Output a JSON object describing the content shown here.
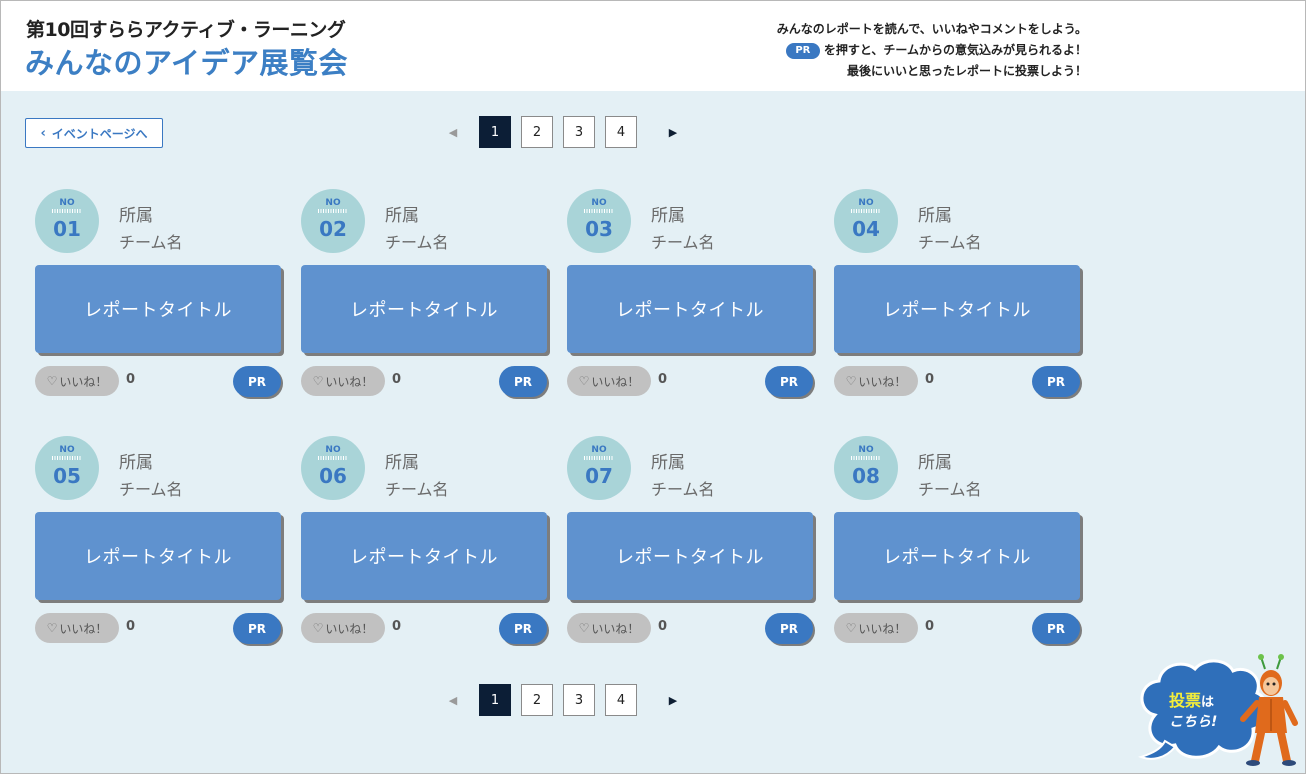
{
  "header": {
    "subtitle": "第10回すららアクティブ・ラーニング",
    "title": "みんなのアイデア展覧会",
    "instruction_line1": "みんなのレポートを読んで、いいねやコメントをしよう。",
    "instruction_pr_label": "PR",
    "instruction_line2": "を押すと、チームからの意気込みが見られるよ！",
    "instruction_line3": "最後にいいと思ったレポートに投票しよう！"
  },
  "back_button": {
    "label": "イベントページへ"
  },
  "pagination": {
    "pages": [
      "1",
      "2",
      "3",
      "4"
    ],
    "current": "1"
  },
  "cards": [
    {
      "no_label": "NO",
      "number": "01",
      "affiliation": "所属",
      "team": "チーム名",
      "title": "レポートタイトル",
      "like_label": "いいね！",
      "likes": "0",
      "pr_label": "PR"
    },
    {
      "no_label": "NO",
      "number": "02",
      "affiliation": "所属",
      "team": "チーム名",
      "title": "レポートタイトル",
      "like_label": "いいね！",
      "likes": "0",
      "pr_label": "PR"
    },
    {
      "no_label": "NO",
      "number": "03",
      "affiliation": "所属",
      "team": "チーム名",
      "title": "レポートタイトル",
      "like_label": "いいね！",
      "likes": "0",
      "pr_label": "PR"
    },
    {
      "no_label": "NO",
      "number": "04",
      "affiliation": "所属",
      "team": "チーム名",
      "title": "レポートタイトル",
      "like_label": "いいね！",
      "likes": "0",
      "pr_label": "PR"
    },
    {
      "no_label": "NO",
      "number": "05",
      "affiliation": "所属",
      "team": "チーム名",
      "title": "レポートタイトル",
      "like_label": "いいね！",
      "likes": "0",
      "pr_label": "PR"
    },
    {
      "no_label": "NO",
      "number": "06",
      "affiliation": "所属",
      "team": "チーム名",
      "title": "レポートタイトル",
      "like_label": "いいね！",
      "likes": "0",
      "pr_label": "PR"
    },
    {
      "no_label": "NO",
      "number": "07",
      "affiliation": "所属",
      "team": "チーム名",
      "title": "レポートタイトル",
      "like_label": "いいね！",
      "likes": "0",
      "pr_label": "PR"
    },
    {
      "no_label": "NO",
      "number": "08",
      "affiliation": "所属",
      "team": "チーム名",
      "title": "レポートタイトル",
      "like_label": "いいね！",
      "likes": "0",
      "pr_label": "PR"
    }
  ],
  "vote_button": {
    "line1": "投票",
    "line1_suffix": "は",
    "line2": "こちら!"
  },
  "icons": {
    "back": "chevron-left-icon",
    "prev": "triangle-left-icon",
    "next": "triangle-right-icon",
    "like": "heart-icon",
    "mascot": "mascot-character-icon"
  },
  "colors": {
    "accent": "#3a78c2",
    "card": "#5f92cf",
    "background": "#e4f0f5",
    "badge": "#a9d4d8",
    "active_page": "#0c1e36"
  }
}
